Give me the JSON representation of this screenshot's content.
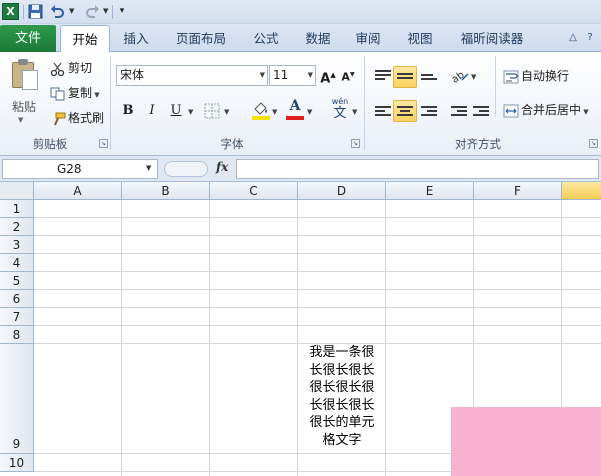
{
  "qat": {
    "logo_text": "X"
  },
  "tabs": {
    "file": "文件",
    "items": [
      "开始",
      "插入",
      "页面布局",
      "公式",
      "数据",
      "审阅",
      "视图",
      "福昕阅读器"
    ],
    "active": "开始"
  },
  "clipboard": {
    "paste": "粘贴",
    "cut": "剪切",
    "copy": "复制",
    "format_painter": "格式刷",
    "group_label": "剪贴板"
  },
  "font": {
    "font_name": "宋体",
    "font_size": "11",
    "bold": "B",
    "italic": "I",
    "underline": "U",
    "font_color_letter": "A",
    "phonetic": "文",
    "phonetic_top": "wén",
    "group_label": "字体"
  },
  "alignment": {
    "wrap_text": "自动换行",
    "merge_center": "合并后居中",
    "group_label": "对齐方式"
  },
  "formula_bar": {
    "name_box": "G28",
    "fx": "fx",
    "formula": ""
  },
  "grid": {
    "columns": [
      "A",
      "B",
      "C",
      "D",
      "E",
      "F",
      ""
    ],
    "rows": [
      "1",
      "2",
      "3",
      "4",
      "5",
      "6",
      "7",
      "8",
      "9",
      "10"
    ],
    "selected_column": 6
  },
  "cell_D9": {
    "lines": [
      "我是一条很",
      "长很长很长",
      "很长很长很",
      "长很长很长",
      "很长的单元",
      "格文字"
    ]
  },
  "colors": {
    "file_tab": "#1f8a42",
    "highlight": "#fbd25d",
    "font_color": "#e02020",
    "fill_color": "#f5e100",
    "overlay": "#f6b2cf"
  }
}
